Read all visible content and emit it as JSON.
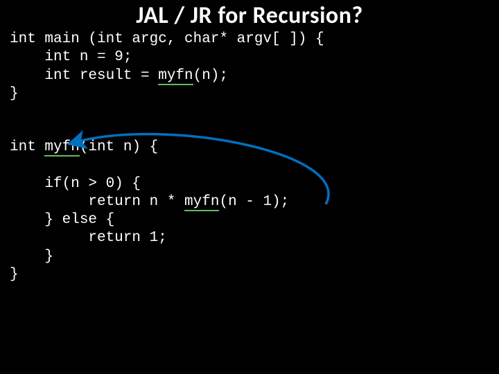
{
  "title": "JAL / JR for Recursion?",
  "code_block_1": {
    "l1a": "int main (int argc, char* argv[ ]) {",
    "l2a": "    int n = 9;",
    "l3a": "    int result = ",
    "l3b": "myfn",
    "l3c": "(n);",
    "l4a": "}"
  },
  "code_block_2": {
    "l1a": "int ",
    "l1b": "myfn",
    "l1c": "(int n) {",
    "l2a": "",
    "l3a": "    if(n > 0) {",
    "l4a": "         return n * ",
    "l4b": "myfn",
    "l4c": "(n - 1);",
    "l5a": "    } else {",
    "l6a": "         return 1;",
    "l7a": "    }",
    "l8a": "}"
  },
  "colors": {
    "bg": "#000000",
    "text": "#ffffff",
    "arrow": "#0070c0",
    "underline": "#5fbf5f"
  }
}
